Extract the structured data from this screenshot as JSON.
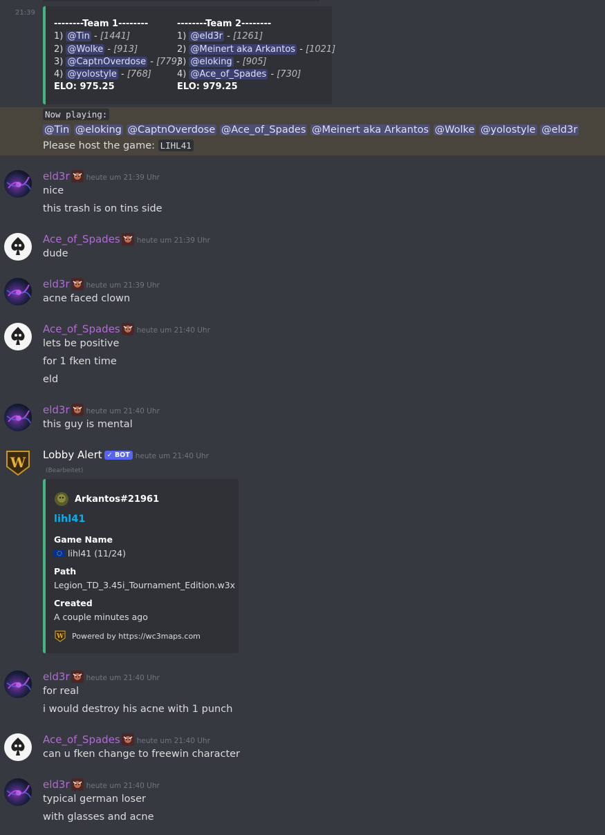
{
  "top_timestamp": "21:39",
  "teams": {
    "team1": {
      "header": "--------Team 1--------",
      "players": [
        {
          "num": "1)",
          "name": "@Tin",
          "rating": "[1441]"
        },
        {
          "num": "2)",
          "name": "@Wolke",
          "rating": "[913]"
        },
        {
          "num": "3)",
          "name": "@CaptnOverdose",
          "rating": "[779]"
        },
        {
          "num": "4)",
          "name": "@yolostyle",
          "rating": "[768]"
        }
      ],
      "elo": "ELO: 975.25"
    },
    "team2": {
      "header": "--------Team 2--------",
      "players": [
        {
          "num": "1)",
          "name": "@eld3r",
          "rating": "[1261]"
        },
        {
          "num": "2)",
          "name": "@Meinert aka Arkantos",
          "rating": "[1021]"
        },
        {
          "num": "3)",
          "name": "@eloking",
          "rating": "[905]"
        },
        {
          "num": "4)",
          "name": "@Ace_of_Spades",
          "rating": "[730]"
        }
      ],
      "elo": "ELO: 979.25"
    }
  },
  "now_playing": {
    "label": "Now playing:",
    "mentions": [
      "@Tin",
      "@eloking",
      "@CaptnOverdose",
      "@Ace_of_Spades",
      "@Meinert aka Arkantos",
      "@Wolke",
      "@yolostyle",
      "@eld3r"
    ],
    "host_text": "Please host the game:",
    "host_code": "LIHL41"
  },
  "messages": [
    {
      "user": "eld3r",
      "time": "heute um 21:39 Uhr",
      "lines": [
        "nice",
        "this trash is on tins side"
      ]
    },
    {
      "user": "Ace_of_Spades",
      "time": "heute um 21:39 Uhr",
      "lines": [
        "dude"
      ]
    },
    {
      "user": "eld3r",
      "time": "heute um 21:39 Uhr",
      "lines": [
        "acne faced clown"
      ]
    },
    {
      "user": "Ace_of_Spades",
      "time": "heute um 21:40 Uhr",
      "lines": [
        "lets be positive",
        "for 1 fken time",
        "eld"
      ]
    },
    {
      "user": "eld3r",
      "time": "heute um 21:40 Uhr",
      "lines": [
        "this guy is mental"
      ]
    },
    {
      "user": "Lobby Alert",
      "bot_badge": "✓ BOT",
      "time": "heute um 21:40 Uhr",
      "edited": "(Bearbeitet)"
    },
    {
      "user": "eld3r",
      "time": "heute um 21:40 Uhr",
      "lines": [
        "for real",
        "i would destroy his acne with 1 punch"
      ]
    },
    {
      "user": "Ace_of_Spades",
      "time": "heute um 21:40 Uhr",
      "lines": [
        "can u fken change to freewin character"
      ]
    },
    {
      "user": "eld3r",
      "time": "heute um 21:40 Uhr",
      "lines": [
        "typical german loser",
        "with glasses and acne"
      ]
    }
  ],
  "lobby_embed": {
    "author": "Arkantos#21961",
    "title": "lihl41",
    "fields": [
      {
        "name": "Game Name",
        "value": "lihl41 (11/24)"
      },
      {
        "name": "Path",
        "value": "Legion_TD_3.45i_Tournament_Edition.w3x"
      },
      {
        "name": "Created",
        "value": "A couple minutes ago"
      }
    ],
    "footer": "Powered by https://wc3maps.com"
  },
  "colors": {
    "background": "#36393f",
    "embed_bg": "#2f3136",
    "embed_border": "#43b581",
    "highlight": "#49443c",
    "username": "#b36bd4",
    "link": "#00aff4",
    "bot_badge": "#5865f2"
  }
}
